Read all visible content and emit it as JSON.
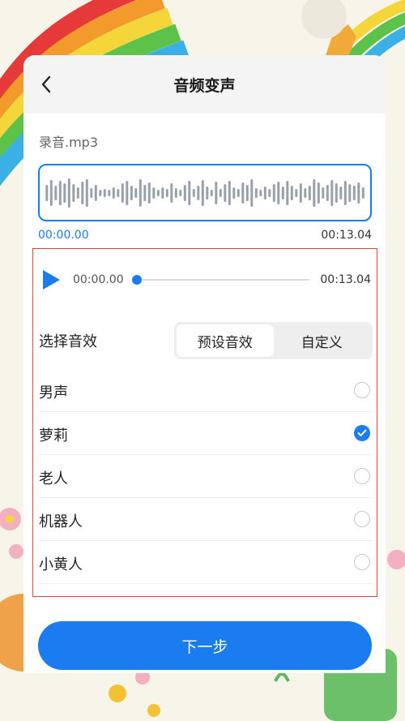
{
  "header": {
    "title": "音频变声"
  },
  "file": {
    "name": "录音.mp3"
  },
  "waveform": {
    "start_time": "00:00.00",
    "end_time": "00:13.04",
    "bars": [
      20,
      32,
      18,
      30,
      24,
      36,
      22,
      14,
      28,
      34,
      12,
      20,
      8,
      10,
      8,
      14,
      10,
      24,
      30,
      18,
      12,
      34,
      20,
      26,
      14,
      8,
      14,
      10,
      24,
      12,
      8,
      20,
      30,
      10,
      18,
      32,
      16,
      8,
      28,
      10,
      22,
      30,
      14,
      10,
      26,
      20,
      34,
      12,
      8,
      16,
      10,
      22,
      28,
      16,
      30,
      18,
      10,
      24,
      12,
      18,
      34,
      26,
      14,
      20,
      32,
      24,
      16,
      30,
      22,
      18,
      26,
      14
    ]
  },
  "player": {
    "current_time": "00:00.00",
    "duration": "00:13.04",
    "progress": 0.0
  },
  "effects": {
    "label": "选择音效",
    "tabs": [
      "预设音效",
      "自定义"
    ],
    "active_tab": 0,
    "options": [
      {
        "label": "男声",
        "selected": false
      },
      {
        "label": "萝莉",
        "selected": true
      },
      {
        "label": "老人",
        "selected": false
      },
      {
        "label": "机器人",
        "selected": false
      },
      {
        "label": "小黄人",
        "selected": false
      }
    ]
  },
  "footer": {
    "next_label": "下一步"
  },
  "colors": {
    "accent": "#1a7cf0",
    "panel_border": "#d9473a"
  }
}
